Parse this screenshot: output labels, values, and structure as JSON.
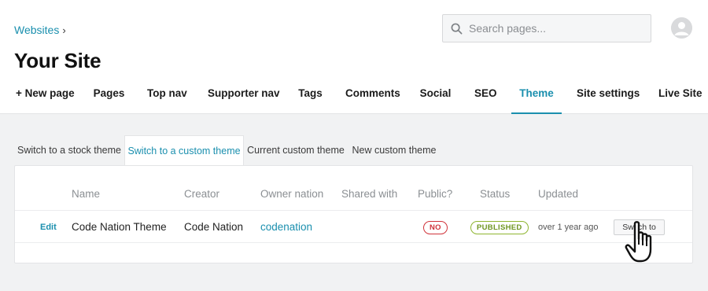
{
  "breadcrumb": {
    "label": "Websites",
    "separator": "›"
  },
  "page_title": "Your Site",
  "search": {
    "placeholder": "Search pages..."
  },
  "nav": {
    "items": [
      {
        "label": "+ New page"
      },
      {
        "label": "Pages"
      },
      {
        "label": "Top nav"
      },
      {
        "label": "Supporter nav"
      },
      {
        "label": "Tags"
      },
      {
        "label": "Comments"
      },
      {
        "label": "Social"
      },
      {
        "label": "SEO"
      },
      {
        "label": "Theme",
        "active": true
      },
      {
        "label": "Site settings"
      },
      {
        "label": "Live Site"
      }
    ]
  },
  "tabs": {
    "items": [
      {
        "label": "Switch to a stock theme"
      },
      {
        "label": "Switch to a custom theme",
        "active": true
      },
      {
        "label": "Current custom theme"
      },
      {
        "label": "New custom theme"
      }
    ]
  },
  "table": {
    "columns": [
      "Name",
      "Creator",
      "Owner nation",
      "Shared with",
      "Public?",
      "Status",
      "Updated"
    ],
    "rows": [
      {
        "edit": "Edit",
        "name": "Code Nation Theme",
        "creator": "Code Nation",
        "owner_nation": "codenation",
        "shared_with": "",
        "public": "NO",
        "status": "PUBLISHED",
        "updated": "over 1 year ago",
        "action": "Switch to"
      }
    ]
  },
  "icons": {
    "search": "search-icon",
    "avatar": "user-avatar-icon",
    "cursor": "hand-pointer-cursor-icon"
  },
  "colors": {
    "accent": "#1a8fae",
    "danger": "#d0333a",
    "success": "#6f9622",
    "background": "#f1f2f3"
  }
}
